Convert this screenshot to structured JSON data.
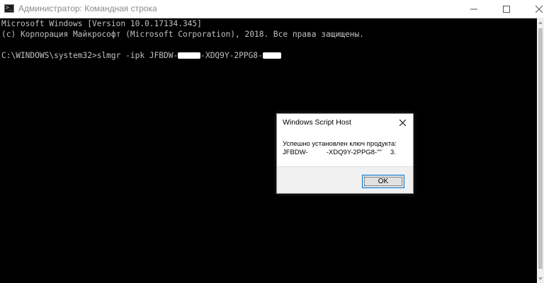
{
  "window": {
    "title": "Администратор: Командная строка",
    "icon": "console-app-icon",
    "icon_glyph": ">_",
    "controls": {
      "minimize_icon": "minimize-icon",
      "maximize_icon": "maximize-icon",
      "close_icon": "close-icon"
    }
  },
  "console": {
    "text_color": "#c0c0c0",
    "background": "#000000",
    "lines": [
      "Microsoft Windows [Version 10.0.17134.345]",
      "(c) Корпорация Майкрософт (Microsoft Corporation), 2018. Все права защищены.",
      ""
    ],
    "command": {
      "prefix": "C:\\WINDOWS\\system32>slmgr -ipk JFBDW-",
      "middle": "-XDQ9Y-2PPG8-",
      "suffix": ""
    }
  },
  "dialog": {
    "title": "Windows Script Host",
    "message_line1": "Успешно установлен ключ продукта:",
    "message_key_prefix": "JFBDW-",
    "message_key_middle": "-XDQ9Y-2PPG8-",
    "message_key_suffix": "\"\"",
    "message_key_end": "3.",
    "ok_label": "OK",
    "accent_color": "#0078d7"
  }
}
